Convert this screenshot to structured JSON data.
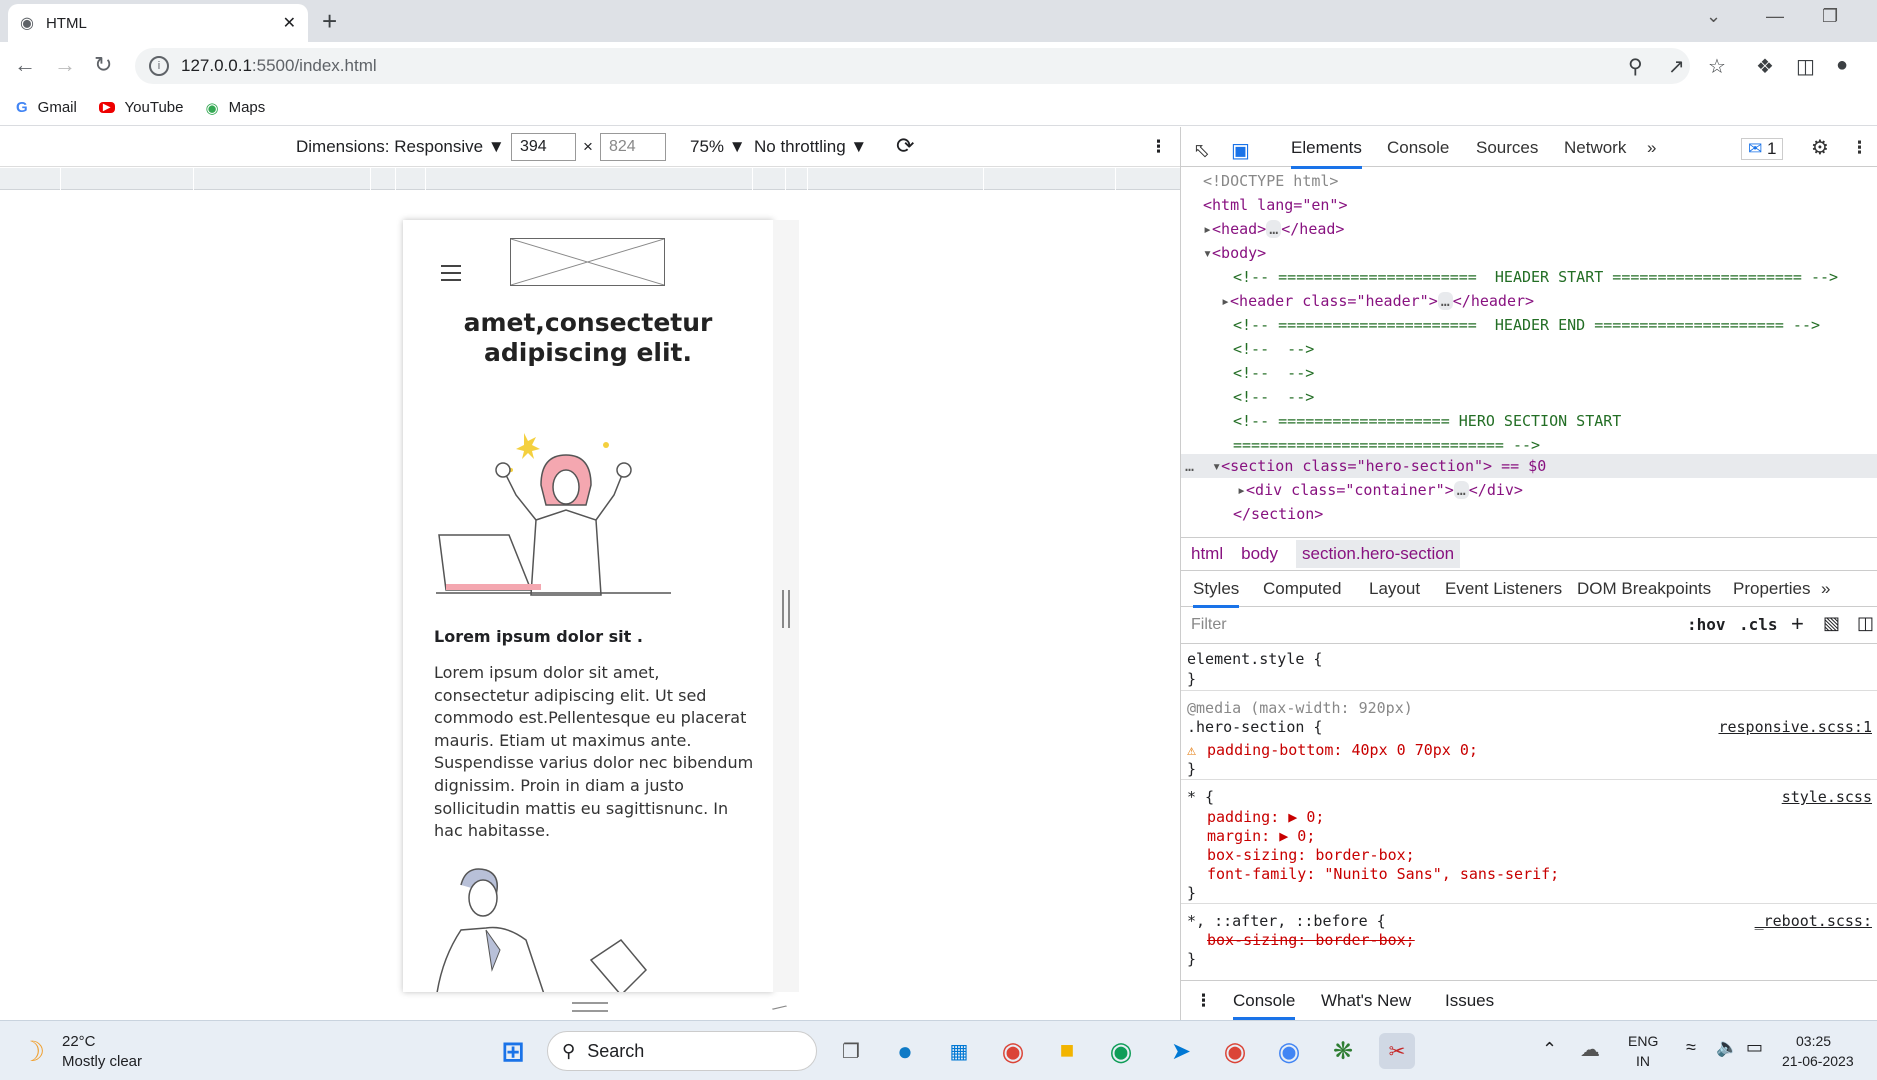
{
  "browser": {
    "tab_title": "HTML",
    "url_host": "127.0.0.1",
    "url_path": ":5500/index.html",
    "bookmarks": [
      "Gmail",
      "YouTube",
      "Maps"
    ]
  },
  "device_toolbar": {
    "dimensions_label": "Dimensions: Responsive",
    "width": "394",
    "height": "824",
    "zoom": "75%",
    "throttling": "No throttling"
  },
  "mobile_page": {
    "hero_title": "amet,consectetur adipiscing elit.",
    "hero_subtitle": "Lorem ipsum dolor sit .",
    "hero_text": "Lorem ipsum dolor sit amet, consectetur adipiscing elit. Ut sed commodo est.Pellentesque eu placerat mauris. Etiam ut maximus ante. Suspendisse varius dolor nec bibendum dignissim. Proin in diam a justo sollicitudin mattis eu sagittisnunc. In hac habitasse."
  },
  "devtools": {
    "tabs": [
      "Elements",
      "Console",
      "Sources",
      "Network"
    ],
    "issues_count": "1",
    "dom_lines": [
      "<!DOCTYPE html>",
      "<html lang=\"en\">",
      "<head>",
      "<body>",
      "<!-- ======================  HEADER START ===================== -->",
      "<header class=\"header\">",
      "<!-- ======================  HEADER END ===================== -->",
      "<!--  -->",
      "<!--  -->",
      "<!--  -->",
      "<!-- =================== HERO SECTION START",
      "============================== -->",
      "<section class=\"hero-section\"> == $0",
      "<div class=\"container\">",
      "</section>"
    ],
    "breadcrumbs": [
      "html",
      "body",
      "section.hero-section"
    ],
    "style_tabs": [
      "Styles",
      "Computed",
      "Layout",
      "Event Listeners",
      "DOM Breakpoints",
      "Properties"
    ],
    "filter_placeholder": "Filter",
    "hov": ":hov",
    "cls": ".cls",
    "styles": {
      "element_style": "element.style {",
      "media": "@media (max-width: 920px)",
      "hero_selector": ".hero-section {",
      "hero_src": "responsive.scss:1",
      "padding_bottom": "padding-bottom: 40px 0 70px 0;",
      "star_selector": "* {",
      "star_src": "style.scss",
      "padding": "padding: ▶ 0;",
      "margin": "margin: ▶ 0;",
      "box_sizing": "box-sizing: border-box;",
      "font_family": "font-family: \"Nunito Sans\", sans-serif;",
      "before_selector": "*, ::after, ::before {",
      "before_src": "_reboot.scss:",
      "box_sizing_strike": "box-sizing: border-box;"
    },
    "drawer_tabs": [
      "Console",
      "What's New",
      "Issues"
    ]
  },
  "taskbar": {
    "temp": "22°C",
    "weather": "Mostly clear",
    "search": "Search",
    "lang1": "ENG",
    "lang2": "IN",
    "time": "03:25",
    "date": "21-06-2023"
  }
}
